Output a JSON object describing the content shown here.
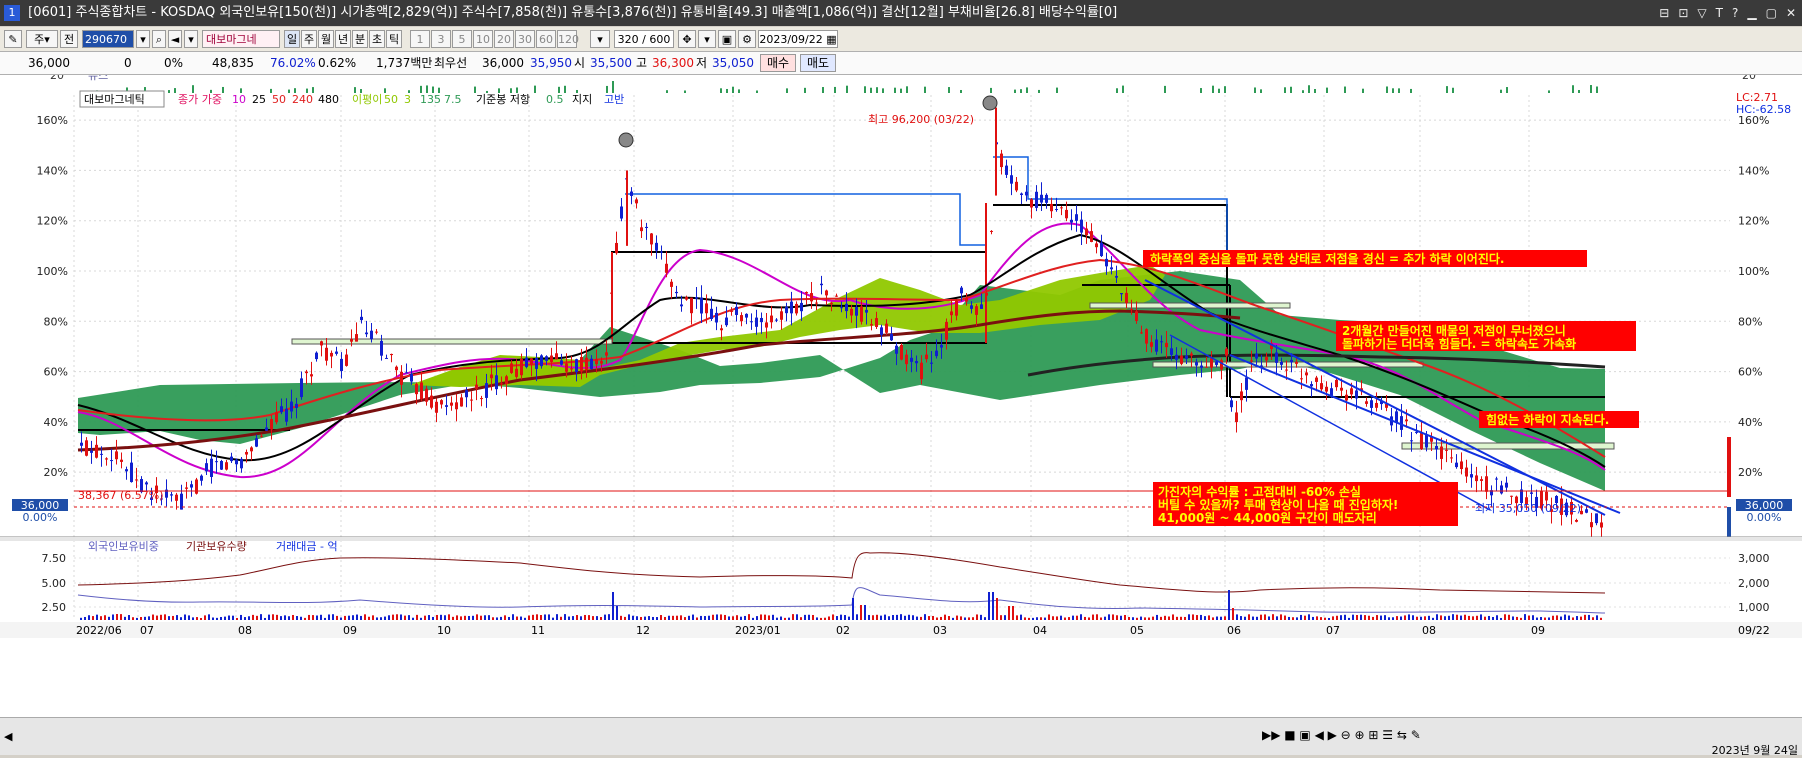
{
  "window": {
    "title": "[0601] 주식종합차트 - KOSDAQ 외국인보유[150(천)] 시가총액[2,829(억)] 주식수[7,858(천)] 유통수[3,876(천)] 유통비율[49.3] 매출액[1,086(억)] 결산[12월] 부채비율[26.8] 배당수익률[0]",
    "badge": "1",
    "controls": [
      "⊟",
      "⊡",
      "▽",
      "T",
      "?",
      "▁",
      "▢",
      "✕"
    ]
  },
  "toolbar": {
    "market": "주",
    "prev": "전",
    "code": "290670",
    "name": "대보마그네",
    "periods": [
      "일",
      "주",
      "월",
      "년",
      "분",
      "초",
      "틱"
    ],
    "minutes": [
      "1",
      "3",
      "5",
      "10",
      "20",
      "30",
      "60",
      "120"
    ],
    "count": "320 / 600",
    "date": "2023/09/22"
  },
  "quote": {
    "price": "36,000",
    "change": "0",
    "change_pct": "0%",
    "volume": "48,835",
    "turnover_rate": "76.02%",
    "vol_pct": "0.62%",
    "amount": "1,737백만",
    "best_bid_label": "최우선",
    "best_bid": "36,000",
    "best_ask": "35,950",
    "open_label": "시",
    "open": "35,500",
    "high_label": "고",
    "high": "36,300",
    "low_label": "저",
    "low": "35,050",
    "buy_label": "매수",
    "sell_label": "매도"
  },
  "colors": {
    "bull": "#e01010",
    "bear": "#1020d0",
    "ma5": "#e01060",
    "ma10": "#cc00cc",
    "ma20": "#e02020",
    "ma60": "#000000",
    "ma120": "#7a1010",
    "cloud_green": "#2e9a55",
    "cloud_lime": "#90c800",
    "annotation_bg": "#ff0000",
    "annotation_text": "#ffff00"
  },
  "chart_data": {
    "type": "candlestick",
    "stock": "대보마그네틱",
    "x_axis_labels": [
      "2022/06",
      "07",
      "08",
      "09",
      "10",
      "11",
      "12",
      "2023/01",
      "02",
      "03",
      "04",
      "05",
      "06",
      "07",
      "08",
      "09"
    ],
    "y_axis_labels": [
      "160%",
      "140%",
      "120%",
      "100%",
      "80%",
      "60%",
      "40%",
      "20%",
      "0.00%"
    ],
    "y_axis_unit": "percent",
    "ylim": [
      -5,
      170
    ],
    "legend": {
      "stock_label": "대보마그네틱",
      "price_ma_label": "종가 가중",
      "ma_periods": [
        "10",
        "25",
        "50",
        "240",
        "480"
      ],
      "ichimoku_label": "이평이",
      "ichimoku_params": [
        "50",
        "3",
        "135",
        "7.5"
      ],
      "base_label": "기준봉 저항",
      "base_param": "0.5",
      "support_label": "지지",
      "high_label": "고반"
    },
    "top_right_labels": [
      "LC:2.71",
      "HC:-62.58"
    ],
    "news_label": "뉴스",
    "news_axis": "20",
    "highest_label": "최고 96,200 (03/22)",
    "lowest_label": "최저 35,050 (09/22)",
    "base_line_label": "38,367 (6.57%)",
    "current_price_label": "36,000",
    "current_pct_label": "0.00%",
    "approx_high_pct": "160",
    "approx_low_pct": "-3",
    "annotations": [
      {
        "text": "하락폭의 중심을 돌파 못한 상태로 저점을 경신 = 추가 하락 이어진다."
      },
      {
        "text": "2개월간 만들어진 매물의 저점이 무너졌으니",
        "text2": "돌파하기는 더더욱 힘들다. = 하락속도 가속화"
      },
      {
        "text": "힘없는 하락이 지속된다."
      },
      {
        "text": "가진자의 수익률 : 고점대비 -60% 손실",
        "text2": "버틸 수 있을까? 투매 현상이 나올 때 진입하자!",
        "text3": "41,000원 ~ 44,000원 구간이 매도자리"
      }
    ],
    "sub_chart": {
      "legend": [
        "외국인보유비중",
        "기관보유수량",
        "거래대금 - 억"
      ],
      "left_ticks": [
        "7.50",
        "5.00",
        "2.50"
      ],
      "right_ticks": [
        "3,000",
        "2,000",
        "1,000"
      ]
    },
    "statusbar": {
      "date_tag": "09/22",
      "footer": "2023년 9월 24일"
    }
  }
}
